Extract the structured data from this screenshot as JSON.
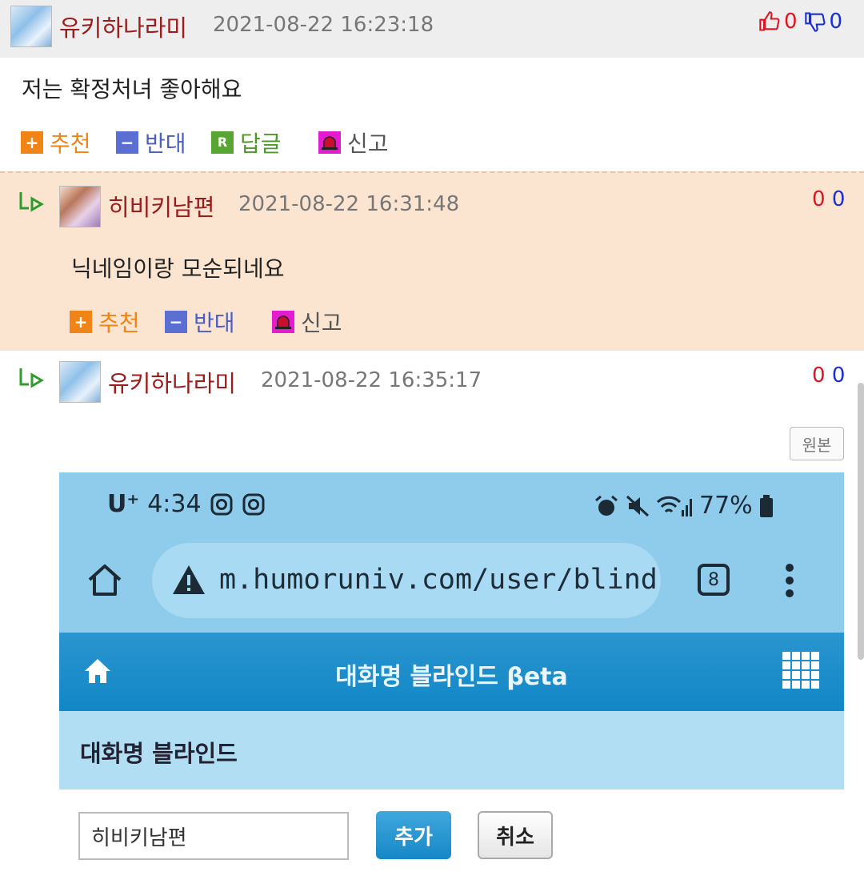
{
  "comment1": {
    "nickname": "유키하나라미",
    "date": "2021-08-22 16:23:18",
    "upvotes": "0",
    "downvotes": "0",
    "text": "저는 확정처녀 좋아해요",
    "actions": {
      "recommend": "추천",
      "oppose": "반대",
      "reply": "답글",
      "report": "신고"
    },
    "reply_icon_letter": "R"
  },
  "reply1": {
    "nickname": "히비키남편",
    "date": "2021-08-22 16:31:48",
    "upvotes": "0",
    "downvotes": "0",
    "text": "닉네임이랑 모순되네요",
    "actions": {
      "recommend": "추천",
      "oppose": "반대",
      "report": "신고"
    }
  },
  "reply2": {
    "nickname": "유키하나라미",
    "date": "2021-08-22 16:35:17",
    "upvotes": "0",
    "downvotes": "0",
    "original_button": "원본"
  },
  "embedded_screenshot": {
    "carrier": "U⁺",
    "time": "4:34",
    "battery": "77%",
    "url": "m.humoruniv.com/user/blind",
    "tab_count": "8",
    "nav_title": "대화명 블라인드 βeta",
    "section_title": "대화명 블라인드",
    "input_value": "히비키남편",
    "add_button": "추가",
    "cancel_button": "취소"
  },
  "colors": {
    "nickname": "#9b1c1c",
    "upvote": "#e0141e",
    "downvote": "#1a2fd1",
    "reply_bg": "#fbe5d1",
    "header_bg": "#eeeeee",
    "nav_blue": "#1187c6"
  },
  "icons": [
    "thumbs-up-icon",
    "thumbs-down-icon",
    "plus-icon",
    "minus-icon",
    "reply-icon",
    "siren-icon",
    "reply-arrow-icon",
    "home-icon",
    "warning-icon",
    "menu-dots-icon",
    "grid-icon"
  ]
}
